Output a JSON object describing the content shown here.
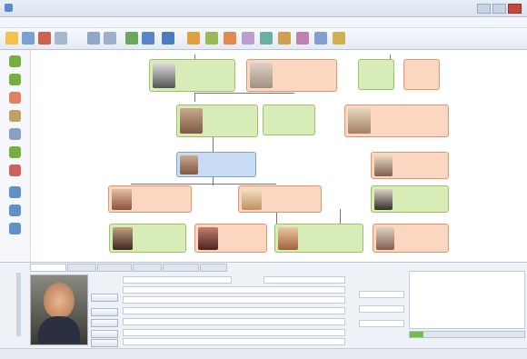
{
  "window": {
    "title": ""
  },
  "menus": [],
  "statusbar": {
    "text": ""
  },
  "tabs": [],
  "editor": {
    "labels": [],
    "buttons": []
  },
  "colors": {
    "male": "#d8ecb8",
    "female": "#fbd6c0",
    "selected": "#c9dcf4"
  },
  "icons": [
    "app-icon",
    "open-folder-icon",
    "save-icon",
    "print-icon",
    "add-person-icon",
    "delete-icon",
    "zoom-icon",
    "tree-icon"
  ]
}
